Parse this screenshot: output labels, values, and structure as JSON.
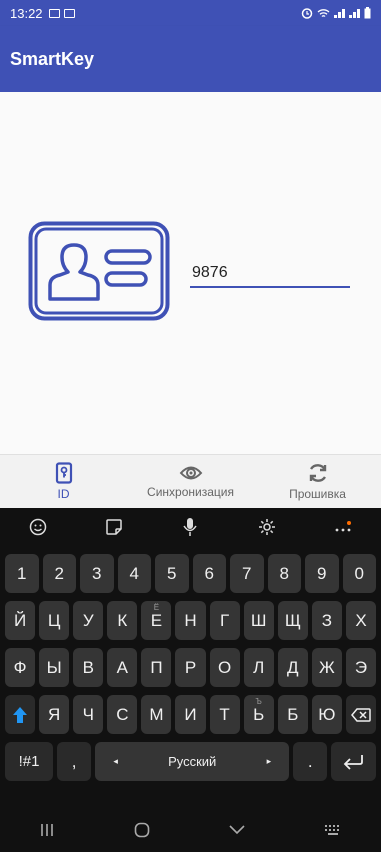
{
  "status_bar": {
    "time": "13:22"
  },
  "app_bar": {
    "title": "SmartKey"
  },
  "id_field": {
    "value": "9876"
  },
  "bottom_nav": {
    "items": [
      {
        "label": "ID",
        "icon": "phone-key-icon",
        "active": true
      },
      {
        "label": "Синхронизация",
        "icon": "sync-eye-icon",
        "active": false
      },
      {
        "label": "Прошивка",
        "icon": "refresh-icon",
        "active": false
      }
    ]
  },
  "keyboard": {
    "toolbar": [
      "emoji-icon",
      "sticker-icon",
      "mic-icon",
      "settings-icon",
      "more-icon"
    ],
    "row_numbers": [
      "1",
      "2",
      "3",
      "4",
      "5",
      "6",
      "7",
      "8",
      "9",
      "0"
    ],
    "row1": [
      "Й",
      "Ц",
      "У",
      "К",
      "Е",
      "Н",
      "Г",
      "Ш",
      "Щ",
      "З",
      "Х"
    ],
    "row1_hint_e": "Ё",
    "row2": [
      "Ф",
      "Ы",
      "В",
      "А",
      "П",
      "Р",
      "О",
      "Л",
      "Д",
      "Ж",
      "Э"
    ],
    "row3": [
      "Я",
      "Ч",
      "С",
      "М",
      "И",
      "Т",
      "Ь",
      "Б",
      "Ю"
    ],
    "row3_hint_soft": "Ъ",
    "symbols_key": "!#1",
    "comma_key": ",",
    "space_label": "Русский",
    "period_key": "."
  },
  "colors": {
    "primary": "#3f51b5",
    "keyboard_bg": "#111111",
    "key_bg": "#353535",
    "shift_blue": "#2196f3"
  }
}
